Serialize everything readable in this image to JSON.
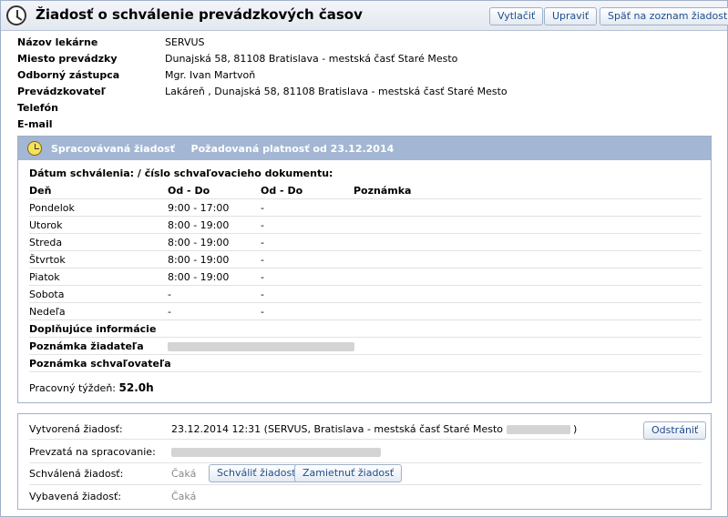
{
  "header": {
    "title": "Žiadosť o schválenie prevádzkových časov",
    "buttons": {
      "print": "Vytlačiť",
      "edit": "Upraviť",
      "back": "Späť na zoznam žiadostí"
    }
  },
  "pharmacy": {
    "name_label": "Názov lekárne",
    "name": "SERVUS",
    "location_label": "Miesto prevádzky",
    "location": "Dunajská 58, 81108 Bratislava - mestská časť Staré Mesto",
    "rep_label": "Odborný zástupca",
    "rep": "Mgr. Ivan Martvoň",
    "operator_label": "Prevádzkovateľ",
    "operator": "Lakáreň , Dunajská 58, 81108 Bratislava - mestská časť Staré Mesto",
    "phone_label": "Telefón",
    "email_label": "E-mail"
  },
  "request": {
    "status": "Spracovávaná žiadosť",
    "validity": "Požadovaná platnosť od 23.12.2014",
    "approval_label": "Dátum schválenia: / číslo schvaľovacieho dokumentu:",
    "columns": [
      "Deň",
      "Od - Do",
      "Od - Do",
      "Poznámka"
    ],
    "days": [
      {
        "day": "Pondelok",
        "time1": "9:00 - 17:00",
        "time2": "-"
      },
      {
        "day": "Utorok",
        "time1": "8:00 - 19:00",
        "time2": "-"
      },
      {
        "day": "Streda",
        "time1": "8:00 - 19:00",
        "time2": "-"
      },
      {
        "day": "Štvrtok",
        "time1": "8:00 - 19:00",
        "time2": "-"
      },
      {
        "day": "Piatok",
        "time1": "8:00 - 19:00",
        "time2": "-"
      },
      {
        "day": "Sobota",
        "time1": "-",
        "time2": "-"
      },
      {
        "day": "Nedeľa",
        "time1": "-",
        "time2": "-"
      }
    ],
    "extra_label": "Doplňujúce informácie",
    "applicant_note_label": "Poznámka žiadateľa",
    "approver_note_label": "Poznámka schvaľovateľa",
    "week_label": "Pracovný týždeň:",
    "week_value": "52.0h"
  },
  "workflow": {
    "created_label": "Vytvorená žiadosť:",
    "created_value": "23.12.2014 12:31 (SERVUS, Bratislava - mestská časť Staré Mesto",
    "created_close": ")",
    "delete_button": "Odstrániť",
    "taken_label": "Prevzatá na spracovanie:",
    "approved_label": "Schválená žiadosť:",
    "approved_status": "Čaká",
    "approve_button": "Schváliť žiadosť",
    "reject_button": "Zamietnuť žiadosť",
    "done_label": "Vybavená žiadosť:",
    "done_status": "Čaká"
  }
}
